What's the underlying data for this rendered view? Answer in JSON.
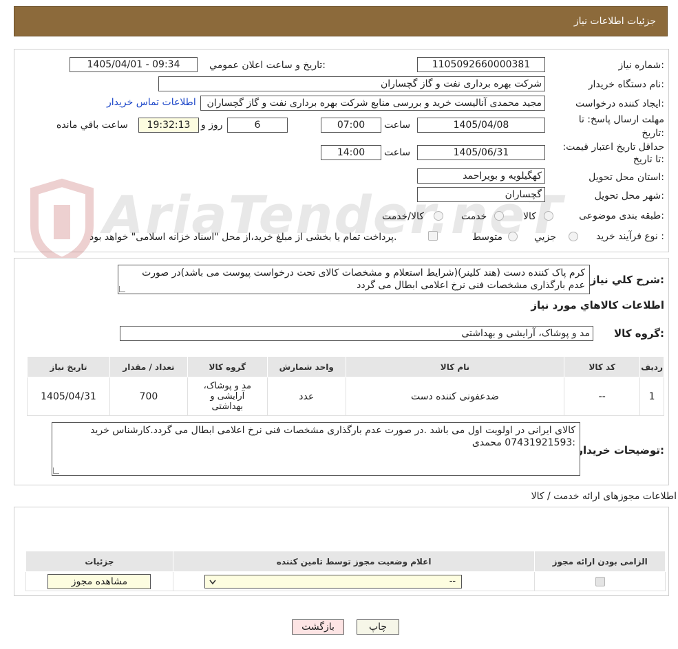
{
  "header": {
    "title": "جزئیات اطلاعات نیاز"
  },
  "form": {
    "need_number_label": "شماره نیاز:",
    "need_number": "1105092660000381",
    "announce_label": "تاریخ و ساعت اعلان عمومي:",
    "announce_value": "1405/04/01 - 09:34",
    "buyer_org_label": "نام دستگاه خريدار:",
    "buyer_org": "شرکت بهره برداری نفت و گاز گچساران",
    "creator_label": "ايجاد کننده درخواست:",
    "creator": "مجید محمدی آنالیست خرید و بررسی منابع شرکت بهره برداری نفت و گاز گچساران",
    "contact_link": "اطلاعات تماس خريدار",
    "reply_deadline_label": "مهلت ارسال پاسخ: تا تاریخ:",
    "reply_date": "1405/04/08",
    "time_label": "ساعت",
    "reply_time": "07:00",
    "days_value": "6",
    "days_label": "روز و",
    "remaining_time": "19:32:13",
    "remaining_label": "ساعت باقي مانده",
    "price_validity_label": "حداقل تاريخ اعتبار قيمت: تا تاریخ:",
    "price_date": "1405/06/31",
    "price_time": "14:00",
    "province_label": "استان محل تحويل:",
    "province": "کهگیلویه و بویراحمد",
    "city_label": "شهر محل تحويل:",
    "city": "گچساران",
    "category_label": "طبقه بندی موضوعی:",
    "category_options": [
      "کالا",
      "خدمت",
      "کالا/خدمت"
    ],
    "process_label": "نوع فرآيند خريد :",
    "process_options": [
      "جزيي",
      "متوسط"
    ],
    "treasury_note": "پرداخت تمام یا بخشی از مبلغ خرید،از محل \"اسناد خزانه اسلامی\" خواهد بود."
  },
  "summary": {
    "label": "شرح کلي نياز:",
    "text": "کرم پاک کننده دست (هند کلینر)(شرایط استعلام و مشخصات کالای تحت درخواست پیوست می باشد)در صورت عدم بارگذاری مشخصات فنی نرخ اعلامی ابطال می گردد",
    "goods_info_title": "اطلاعات کالاهاي مورد نياز",
    "goods_group_label": "گروه کالا:",
    "goods_group": "مد و پوشاک، آرایشی و بهداشتی"
  },
  "goods_table": {
    "headers": [
      "رديف",
      "کد کالا",
      "نام کالا",
      "واحد شمارش",
      "گروه کالا",
      "تعداد / مقدار",
      "تاريخ نياز"
    ],
    "rows": [
      [
        "1",
        "--",
        "ضدعفونی کننده دست",
        "عدد",
        "مد و پوشاک، آرایشی و بهداشتی",
        "700",
        "1405/04/31"
      ]
    ]
  },
  "buyer_notes": {
    "label": "توضيحات خريدار:",
    "text": "کالای ایرانی در اولویت اول می باشد .در صورت عدم بارگذاری مشخصات فنی نرخ اعلامی ابطال می گردد.کارشناس خرید :07431921593 محمدی"
  },
  "permits": {
    "section_title": "اطلاعات مجوزهای ارائه خدمت / کالا",
    "headers": [
      "الزامی بودن ارائه مجوز",
      "اعلام وضعیت مجوز توسط تامین کننده",
      "جزئیات"
    ],
    "select_value": "--",
    "view_button": "مشاهده مجوز"
  },
  "footer": {
    "print_button": "چاپ",
    "back_button": "بازگشت"
  },
  "watermark": {
    "text": "AriaTender.neT"
  }
}
